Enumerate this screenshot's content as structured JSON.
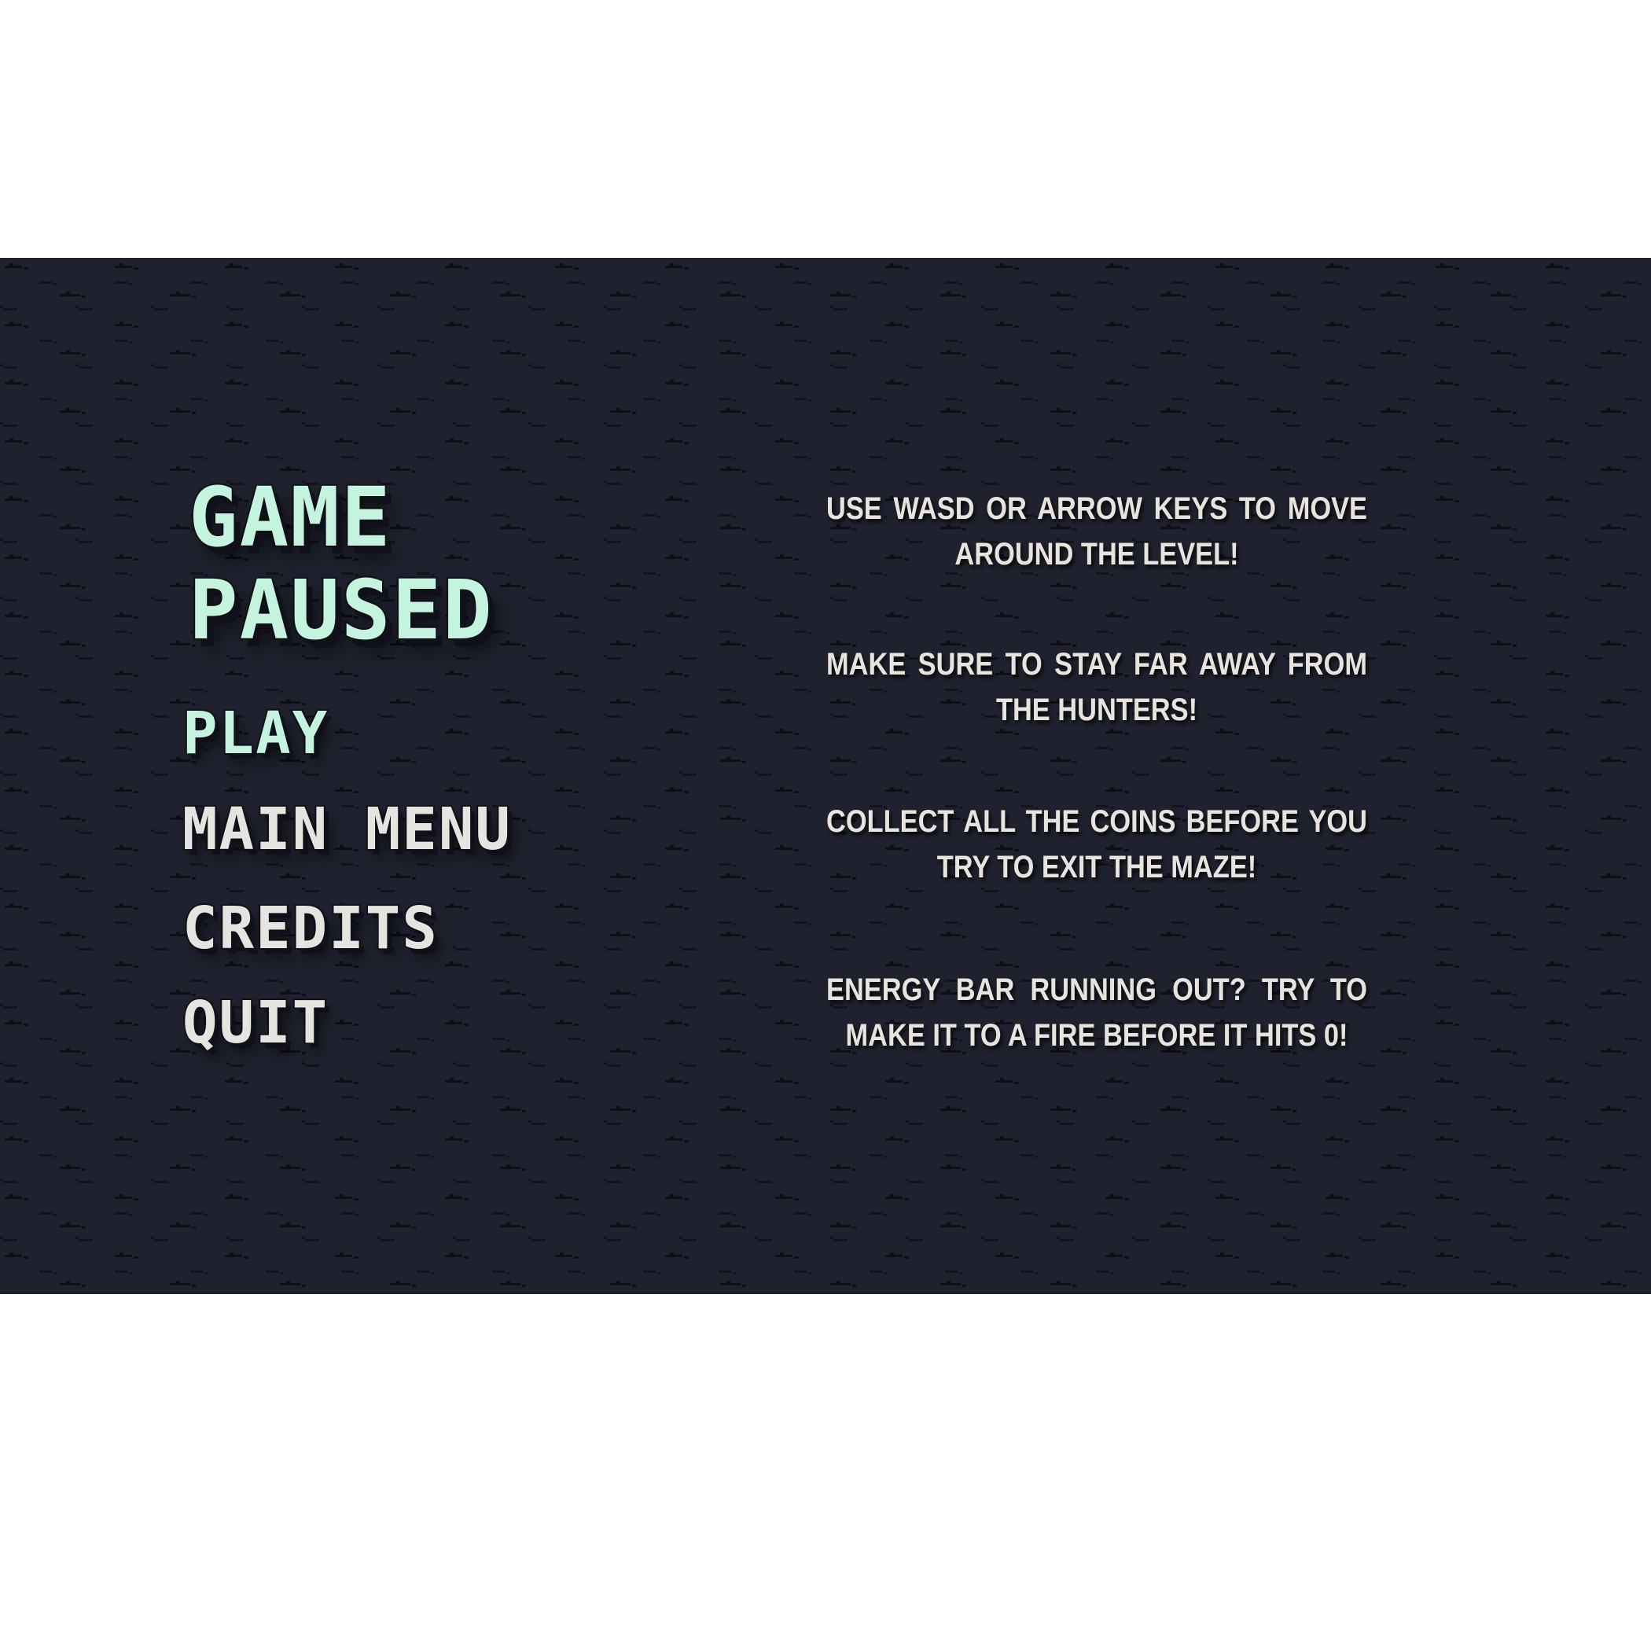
{
  "pause_menu": {
    "title_line1": "GAME",
    "title_line2": "PAUSED",
    "buttons": [
      {
        "label": "PLAY"
      },
      {
        "label": "MAIN MENU"
      },
      {
        "label": "CREDITS"
      },
      {
        "label": "QUIT"
      }
    ]
  },
  "tips": [
    "USE WASD OR ARROW KEYS TO MOVE AROUND THE LEVEL!",
    "MAKE SURE TO STAY FAR AWAY FROM THE HUNTERS!",
    "COLLECT ALL THE COINS BEFORE YOU TRY TO EXIT THE MAZE!",
    "ENERGY BAR RUNNING OUT? TRY TO MAKE IT TO A FIRE BEFORE IT HITS 0!"
  ],
  "colors": {
    "background": "#1f222e",
    "title_mint": "#c4f3de",
    "menu_light": "#e6e4de",
    "outline_dark": "#11121d",
    "tip_text": "#e8e3dc"
  }
}
